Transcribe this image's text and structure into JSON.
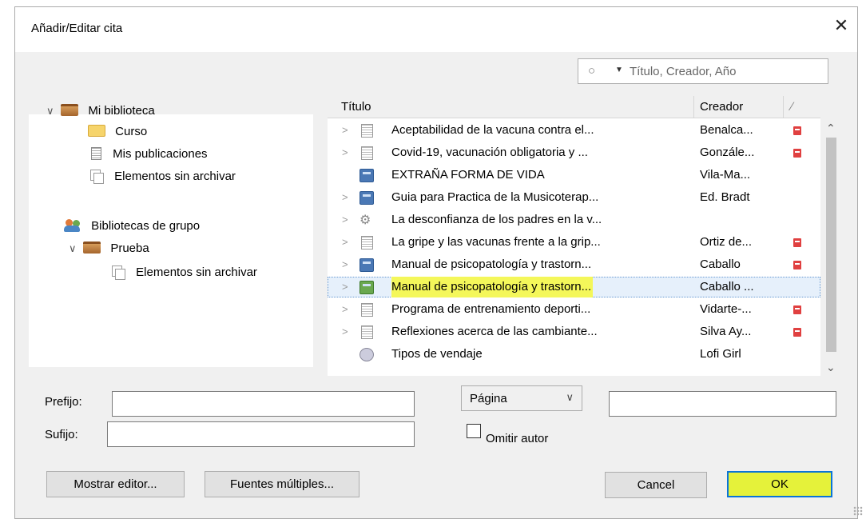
{
  "window": {
    "title": "Añadir/Editar cita",
    "close_glyph": "✕"
  },
  "search": {
    "placeholder": "Título, Creador, Año"
  },
  "tree": {
    "my_library": "Mi biblioteca",
    "items": [
      {
        "label": "Curso",
        "icon": "folder-icon"
      },
      {
        "label": "Mis publicaciones",
        "icon": "document-icon"
      },
      {
        "label": "Elementos sin archivar",
        "icon": "unfiled-icon"
      }
    ],
    "group_libraries": "Bibliotecas de grupo",
    "group": {
      "label": "Prueba",
      "child": "Elementos sin archivar"
    }
  },
  "table": {
    "headers": {
      "title": "Título",
      "creator": "Creador"
    },
    "rows": [
      {
        "title": "Aceptabilidad de la vacuna contra el...",
        "creator": "Benalca...",
        "pdf": true,
        "icon": "document-icon",
        "chev": true
      },
      {
        "title": "Covid-19, vacunación obligatoria y ...",
        "creator": "Gonzále...",
        "pdf": true,
        "icon": "document-icon",
        "chev": true
      },
      {
        "title": "EXTRAÑA FORMA DE VIDA",
        "creator": "Vila-Ma...",
        "pdf": false,
        "icon": "book-icon",
        "chev": false
      },
      {
        "title": "Guia para Practica de la Musicoterap...",
        "creator": "Ed. Bradt",
        "pdf": false,
        "icon": "book-icon",
        "chev": true
      },
      {
        "title": "La desconfianza de los padres en la v...",
        "creator": "",
        "pdf": false,
        "icon": "link-icon",
        "chev": true
      },
      {
        "title": "La gripe y las vacunas frente a la grip...",
        "creator": "Ortiz de...",
        "pdf": true,
        "icon": "document-icon",
        "chev": true
      },
      {
        "title": "Manual de psicopatología y trastorn...",
        "creator": "Caballo",
        "pdf": true,
        "icon": "book-icon",
        "chev": true
      },
      {
        "title": "Manual de psicopatología y trastorn...",
        "creator": "Caballo ...",
        "pdf": false,
        "icon": "book-icon-green",
        "chev": true,
        "selected": true
      },
      {
        "title": "Programa de entrenamiento deporti...",
        "creator": "Vidarte-...",
        "pdf": true,
        "icon": "document-icon",
        "chev": true
      },
      {
        "title": "Reflexiones acerca de las cambiante...",
        "creator": "Silva Ay...",
        "pdf": true,
        "icon": "document-icon",
        "chev": true
      },
      {
        "title": "Tipos de vendaje",
        "creator": "Lofi Girl",
        "pdf": false,
        "icon": "video-icon",
        "chev": false
      }
    ]
  },
  "form": {
    "prefix_label": "Prefijo:",
    "suffix_label": "Sufijo:",
    "prefix_value": "",
    "suffix_value": "",
    "locator_selected": "Página",
    "locator_value": "",
    "omit_author": "Omitir autor"
  },
  "buttons": {
    "show_editor": "Mostrar editor...",
    "multiple_sources": "Fuentes múltiples...",
    "cancel": "Cancel",
    "ok": "OK"
  },
  "colors": {
    "highlight": "#f4f75a",
    "ok_button": "#e5f23a",
    "focus_border": "#0a74d8"
  }
}
